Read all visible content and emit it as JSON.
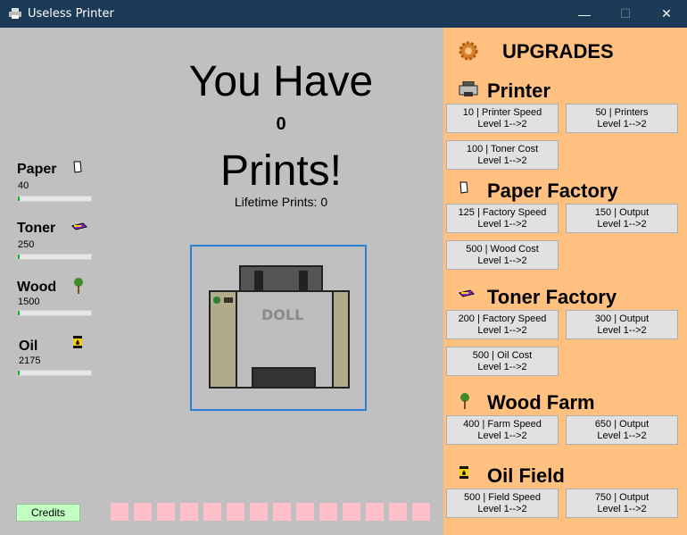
{
  "window": {
    "title": "Useless Printer",
    "minimize": "—",
    "maximize": "☐",
    "close": "✕"
  },
  "main": {
    "line1": "You Have",
    "count": "0",
    "line3": "Prints!",
    "lifetime": "Lifetime Prints: 0"
  },
  "resources": [
    {
      "name": "Paper",
      "value": "40",
      "progress": 0.02
    },
    {
      "name": "Toner",
      "value": "250",
      "progress": 0.02
    },
    {
      "name": "Wood",
      "value": "1500",
      "progress": 0.02
    },
    {
      "name": "Oil",
      "value": "2175",
      "progress": 0.02
    }
  ],
  "printer_image": {
    "brand": "DOLL"
  },
  "credits": "Credits",
  "slots_count": 14,
  "upgrades": {
    "title": "UPGRADES",
    "sections": [
      {
        "title": "Printer",
        "icon": "printer-icon",
        "buttons": [
          {
            "line1": "10 | Printer Speed",
            "line2": "Level 1-->2"
          },
          {
            "line1": "50 | Printers",
            "line2": "Level 1-->2"
          },
          {
            "line1": "100 | Toner Cost",
            "line2": "Level 1-->2"
          }
        ]
      },
      {
        "title": "Paper Factory",
        "icon": "paper-icon",
        "buttons": [
          {
            "line1": "125 | Factory Speed",
            "line2": "Level 1-->2"
          },
          {
            "line1": "150 | Output",
            "line2": "Level 1-->2"
          },
          {
            "line1": "500 | Wood Cost",
            "line2": "Level 1-->2"
          }
        ]
      },
      {
        "title": "Toner Factory",
        "icon": "toner-icon",
        "buttons": [
          {
            "line1": "200 | Factory Speed",
            "line2": "Level 1-->2"
          },
          {
            "line1": "300 | Output",
            "line2": "Level 1-->2"
          },
          {
            "line1": "500 | Oil Cost",
            "line2": "Level 1-->2"
          }
        ]
      },
      {
        "title": "Wood Farm",
        "icon": "tree-icon",
        "buttons": [
          {
            "line1": "400 | Farm Speed",
            "line2": "Level 1-->2"
          },
          {
            "line1": "650 | Output",
            "line2": "Level 1-->2"
          }
        ]
      },
      {
        "title": "Oil Field",
        "icon": "oil-barrel-icon",
        "buttons": [
          {
            "line1": "500 | Field Speed",
            "line2": "Level 1-->2"
          },
          {
            "line1": "750 | Output",
            "line2": "Level 1-->2"
          }
        ]
      }
    ]
  },
  "colors": {
    "title_bar": "#1b3a55",
    "left_bg": "#c0c0c0",
    "right_bg": "#ffc080",
    "progress": "#06b025",
    "credits_bg": "#c0ffc0",
    "slot": "#ffc0cb",
    "printer_border": "#2a7fd4"
  }
}
